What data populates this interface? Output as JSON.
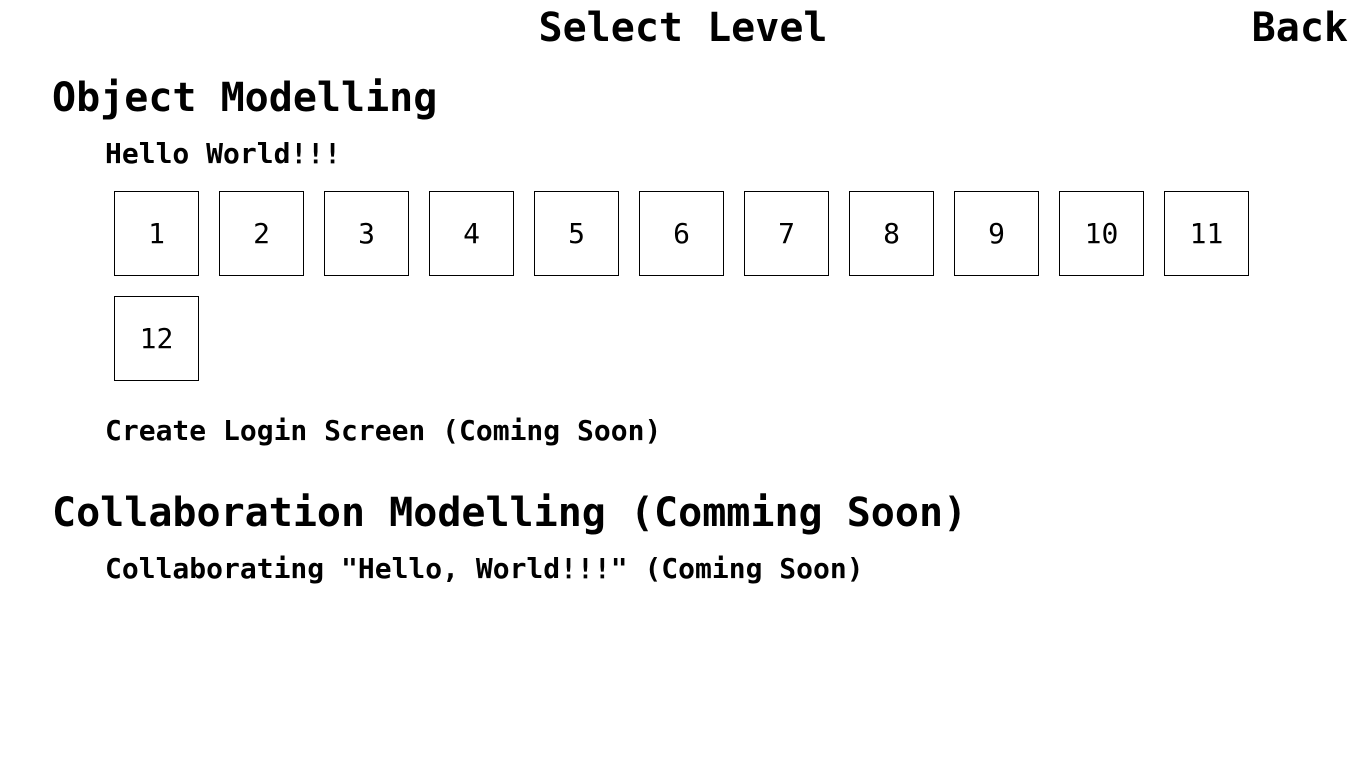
{
  "header": {
    "title": "Select Level",
    "back_label": "Back"
  },
  "sections": [
    {
      "heading": "Object Modelling",
      "groups": [
        {
          "title": "Hello World!!!",
          "levels": [
            "1",
            "2",
            "3",
            "4",
            "5",
            "6",
            "7",
            "8",
            "9",
            "10",
            "11",
            "12"
          ]
        },
        {
          "title": "Create Login Screen (Coming Soon)"
        }
      ]
    },
    {
      "heading": "Collaboration Modelling (Comming Soon)",
      "groups": [
        {
          "title": "Collaborating \"Hello, World!!!\" (Coming Soon)"
        }
      ]
    }
  ]
}
